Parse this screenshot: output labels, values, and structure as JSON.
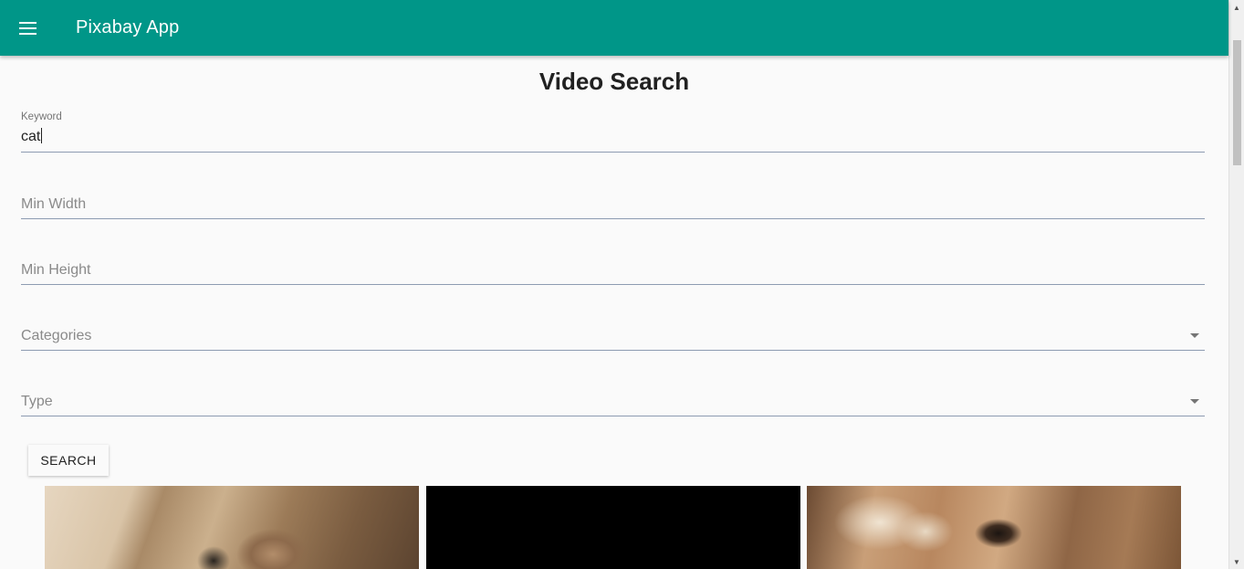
{
  "appbar": {
    "menu_icon": "menu-icon",
    "title": "Pixabay App",
    "background_color": "#009688"
  },
  "page": {
    "title": "Video Search"
  },
  "form": {
    "keyword": {
      "label": "Keyword",
      "value": "cat"
    },
    "min_width": {
      "placeholder": "Min Width",
      "value": ""
    },
    "min_height": {
      "placeholder": "Min Height",
      "value": ""
    },
    "categories": {
      "placeholder": "Categories",
      "selected": "",
      "icon": "chevron-down-icon"
    },
    "type": {
      "placeholder": "Type",
      "selected": "",
      "icon": "chevron-down-icon"
    },
    "search_button_label": "SEARCH"
  },
  "results": {
    "videos": [
      {
        "description": "cat video thumbnail"
      },
      {
        "description": "black video thumbnail"
      },
      {
        "description": "cat close-up video thumbnail"
      }
    ]
  }
}
